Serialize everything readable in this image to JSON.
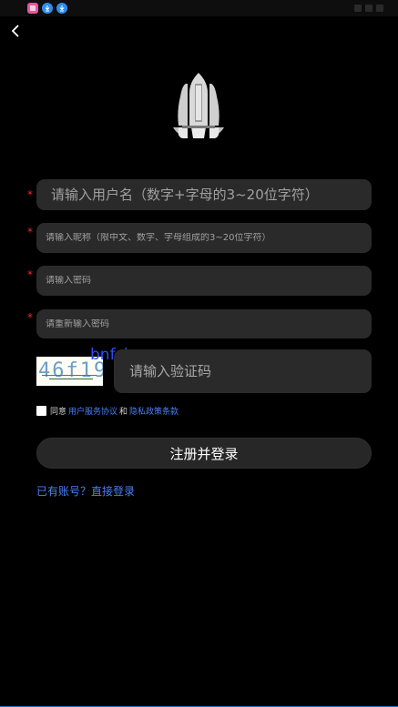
{
  "status_bar": {
    "icons": [
      "app-icon",
      "download-icon",
      "download-icon"
    ]
  },
  "nav": {
    "back_icon": "chevron-left-icon"
  },
  "form": {
    "username_placeholder": "请输入用户名（数字+字母的3~20位字符）",
    "nickname_placeholder": "请输入昵称（限中文、数字、字母组成的3~20位字符）",
    "password_placeholder": "请输入密码",
    "confirm_password_placeholder": "请重新输入密码",
    "captcha_text": "46f19",
    "captcha_placeholder": "请输入验证码",
    "required_mark": "*"
  },
  "watermark": "bnfcjr.com",
  "agreement": {
    "prefix": "同意",
    "terms_link": "用户服务协议",
    "and": "和",
    "privacy_link": "隐私政策条款"
  },
  "submit_label": "注册并登录",
  "login_link": "已有账号？直接登录",
  "colors": {
    "background": "#000000",
    "field_bg": "#2a2a2a",
    "link": "#4d7ff5",
    "required": "#e0322f"
  }
}
